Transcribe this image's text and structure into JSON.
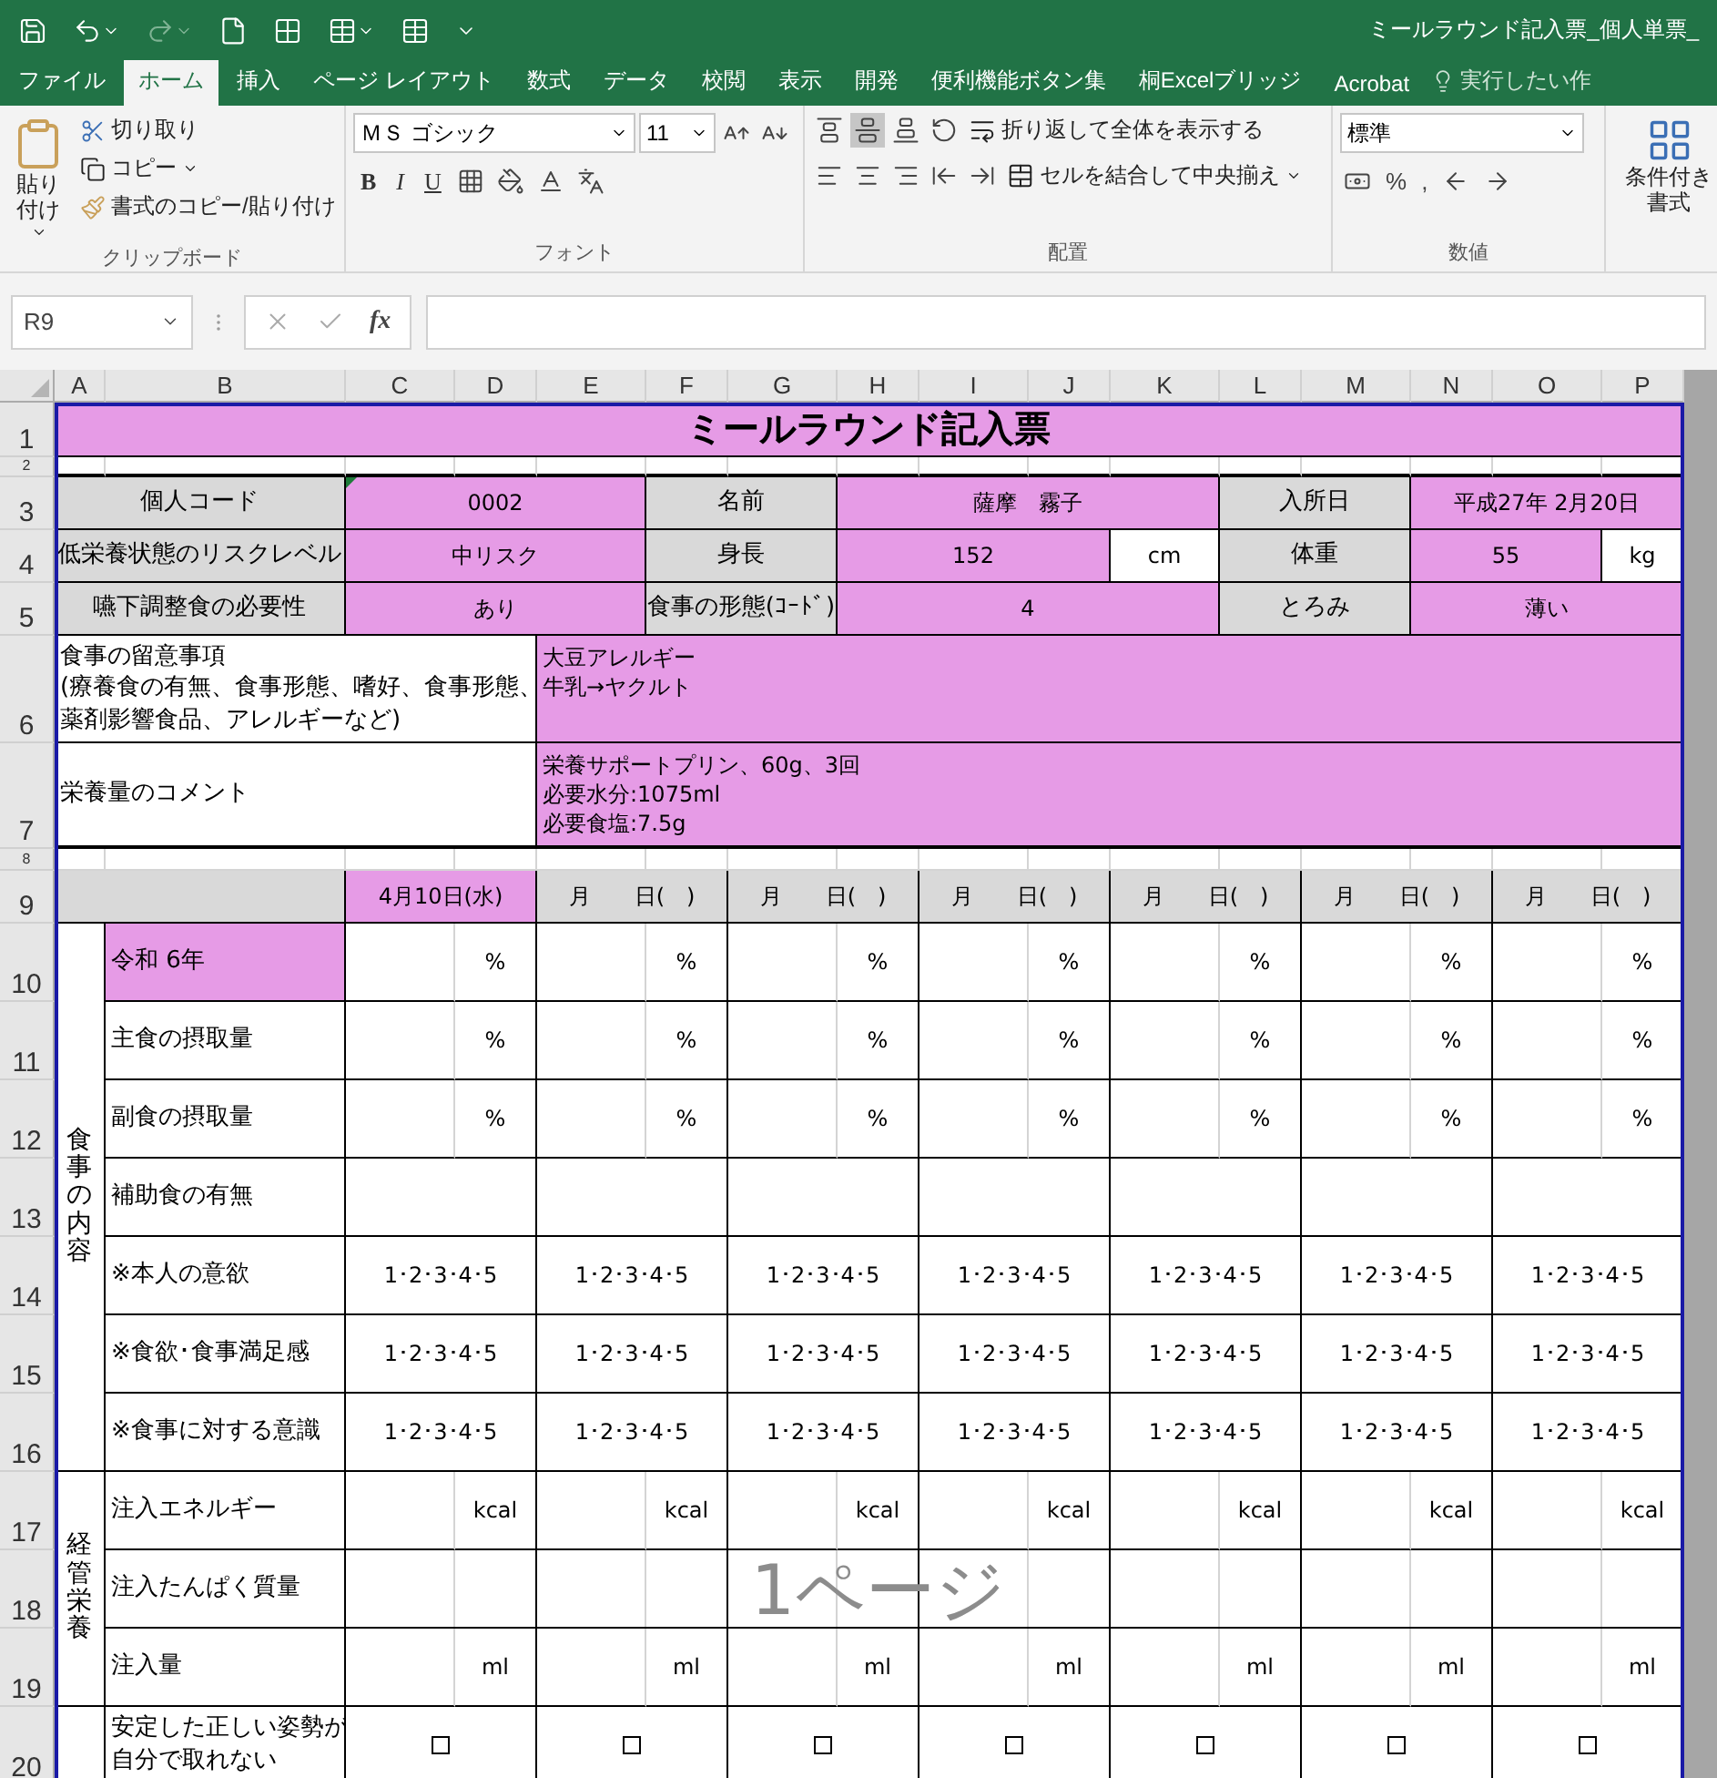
{
  "window": {
    "title": "ミールラウンド記入票_個人単票_"
  },
  "tabs": [
    {
      "label": "ファイル",
      "selected": false
    },
    {
      "label": "ホーム",
      "selected": true
    },
    {
      "label": "挿入",
      "selected": false
    },
    {
      "label": "ページ レイアウト",
      "selected": false
    },
    {
      "label": "数式",
      "selected": false
    },
    {
      "label": "データ",
      "selected": false
    },
    {
      "label": "校閲",
      "selected": false
    },
    {
      "label": "表示",
      "selected": false
    },
    {
      "label": "開発",
      "selected": false
    },
    {
      "label": "便利機能ボタン集",
      "selected": false
    },
    {
      "label": "桐Excelブリッジ",
      "selected": false
    },
    {
      "label": "Acrobat",
      "selected": false
    }
  ],
  "tell_me": {
    "placeholder": "実行したい作"
  },
  "ribbon": {
    "clipboard": {
      "label": "クリップボード",
      "paste": "貼り付け",
      "cut": "切り取り",
      "copy": "コピー",
      "format_painter": "書式のコピー/貼り付け"
    },
    "font": {
      "label": "フォント",
      "name": "ＭＳ ゴシック",
      "size": "11",
      "bold": "B",
      "italic": "I",
      "underline": "U"
    },
    "alignment": {
      "label": "配置",
      "wrap": "折り返して全体を表示する",
      "merge": "セルを結合して中央揃え"
    },
    "number": {
      "label": "数値",
      "format": "標準",
      "percent": "%",
      "comma": ","
    },
    "conditional": {
      "line1": "条件付き",
      "line2": "書式"
    }
  },
  "formula_bar": {
    "name_box": "R9",
    "function_label": "fx"
  },
  "columns": [
    "A",
    "B",
    "C",
    "D",
    "E",
    "F",
    "G",
    "H",
    "I",
    "J",
    "K",
    "L",
    "M",
    "N",
    "O",
    "P"
  ],
  "row_numbers": [
    "1",
    "2",
    "3",
    "4",
    "5",
    "6",
    "7",
    "8",
    "9",
    "10",
    "11",
    "12",
    "13",
    "14",
    "15",
    "16",
    "17",
    "18",
    "19",
    "20"
  ],
  "sheet": {
    "title": "ミールラウンド記入票",
    "info": [
      [
        {
          "label": "個人コード",
          "value": "0002",
          "flagged": true
        },
        {
          "label": "名前",
          "value": "薩摩　霧子",
          "flagged": false
        },
        {
          "label": "入所日",
          "value": "平成27年 2月20日",
          "flagged": false
        }
      ],
      [
        {
          "label": "低栄養状態のリスクレベル",
          "value": "中リスク",
          "flagged": false
        },
        {
          "label": "身長",
          "value": "152",
          "unit": "cm",
          "flagged": false
        },
        {
          "label": "体重",
          "value": "55",
          "unit": "kg",
          "flagged": false
        }
      ],
      [
        {
          "label": "嚥下調整食の必要性",
          "value": "あり",
          "flagged": false
        },
        {
          "label": "食事の形態(ｺｰﾄﾞ)",
          "value": "4",
          "flagged": false
        },
        {
          "label": "とろみ",
          "value": "薄い",
          "flagged": false
        }
      ]
    ],
    "notes": [
      {
        "label": [
          "食事の留意事項",
          "(療養食の有無、食事形態、嗜好、食事形態、",
          "薬剤影響食品、アレルギーなど)"
        ],
        "value": [
          "大豆アレルギー",
          "牛乳→ヤクルト"
        ]
      },
      {
        "label": [
          "栄養量のコメント"
        ],
        "value": [
          "栄養サポートプリン、60g、3回",
          "必要水分:1075ml",
          "必要食塩:7.5g"
        ]
      }
    ],
    "dates": [
      {
        "text": "4月10日(水)",
        "highlight": true
      },
      {
        "text": "月　　日(　)",
        "highlight": false
      },
      {
        "text": "月　　日(　)",
        "highlight": false
      },
      {
        "text": "月　　日(　)",
        "highlight": false
      },
      {
        "text": "月　　日(　)",
        "highlight": false
      },
      {
        "text": "月　　日(　)",
        "highlight": false
      },
      {
        "text": "月　　日(　)",
        "highlight": false
      }
    ],
    "sections": [
      {
        "heading": "食事の内容",
        "rows": [
          {
            "label": "令和 6年",
            "highlight": true,
            "kind": "unit",
            "cells": [
              "%",
              "%",
              "%",
              "%",
              "%",
              "%",
              "%"
            ]
          },
          {
            "label": "主食の摂取量",
            "highlight": false,
            "kind": "unit",
            "cells": [
              "%",
              "%",
              "%",
              "%",
              "%",
              "%",
              "%"
            ]
          },
          {
            "label": "副食の摂取量",
            "highlight": false,
            "kind": "unit",
            "cells": [
              "%",
              "%",
              "%",
              "%",
              "%",
              "%",
              "%"
            ]
          },
          {
            "label": "補助食の有無",
            "highlight": false,
            "kind": "blank"
          },
          {
            "label": "※本人の意欲",
            "highlight": false,
            "kind": "scale",
            "cells": [
              "1･2･3･4･5",
              "1･2･3･4･5",
              "1･2･3･4･5",
              "1･2･3･4･5",
              "1･2･3･4･5",
              "1･2･3･4･5",
              "1･2･3･4･5"
            ]
          },
          {
            "label": "※食欲･食事満足感",
            "highlight": false,
            "kind": "scale",
            "cells": [
              "1･2･3･4･5",
              "1･2･3･4･5",
              "1･2･3･4･5",
              "1･2･3･4･5",
              "1･2･3･4･5",
              "1･2･3･4･5",
              "1･2･3･4･5"
            ]
          },
          {
            "label": "※食事に対する意識",
            "highlight": false,
            "kind": "scale",
            "cells": [
              "1･2･3･4･5",
              "1･2･3･4･5",
              "1･2･3･4･5",
              "1･2･3･4･5",
              "1･2･3･4･5",
              "1･2･3･4･5",
              "1･2･3･4･5"
            ]
          }
        ]
      },
      {
        "heading": "経管栄養",
        "rows": [
          {
            "label": "注入エネルギー",
            "highlight": false,
            "kind": "unit",
            "cells": [
              "kcal",
              "kcal",
              "kcal",
              "kcal",
              "kcal",
              "kcal",
              "kcal"
            ]
          },
          {
            "label": "注入たんぱく質量",
            "highlight": false,
            "kind": "split"
          },
          {
            "label": "注入量",
            "highlight": false,
            "kind": "unit",
            "cells": [
              "ml",
              "ml",
              "ml",
              "ml",
              "ml",
              "ml",
              "ml"
            ]
          }
        ]
      }
    ],
    "posture": {
      "label": [
        "安定した正しい姿勢が",
        "自分で取れない"
      ],
      "checks": [
        {
          "checked": false
        },
        {
          "checked": false
        },
        {
          "checked": false
        },
        {
          "checked": false
        },
        {
          "checked": false
        },
        {
          "checked": false
        },
        {
          "checked": false
        }
      ]
    }
  },
  "page_label": "1ページ"
}
